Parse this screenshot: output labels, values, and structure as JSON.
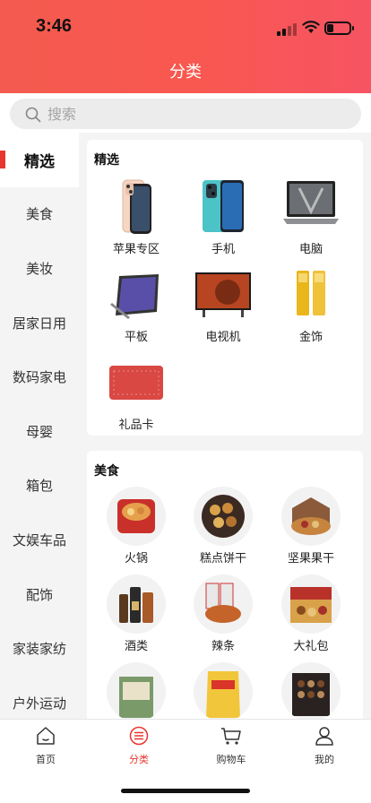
{
  "status": {
    "time": "3:46",
    "battery_level": 0.3
  },
  "header": {
    "title": "分类"
  },
  "search": {
    "placeholder": "搜索"
  },
  "colors": {
    "accent": "#e8352e",
    "header_start": "#f45a4f",
    "header_end": "#f75463"
  },
  "sidebar": {
    "items": [
      {
        "label": "精选",
        "active": true
      },
      {
        "label": "美食"
      },
      {
        "label": "美妆"
      },
      {
        "label": "居家日用"
      },
      {
        "label": "数码家电"
      },
      {
        "label": "母婴"
      },
      {
        "label": "箱包"
      },
      {
        "label": "文娱车品"
      },
      {
        "label": "配饰"
      },
      {
        "label": "家装家纺"
      },
      {
        "label": "户外运动"
      }
    ]
  },
  "sections": [
    {
      "title": "精选",
      "items": [
        {
          "label": "苹果专区",
          "icon": "iphone-icon"
        },
        {
          "label": "手机",
          "icon": "phone-icon"
        },
        {
          "label": "电脑",
          "icon": "laptop-icon"
        },
        {
          "label": "平板",
          "icon": "tablet-icon"
        },
        {
          "label": "电视机",
          "icon": "tv-icon"
        },
        {
          "label": "金饰",
          "icon": "gold-bar-icon"
        },
        {
          "label": "礼品卡",
          "icon": "gift-card-icon"
        }
      ]
    },
    {
      "title": "美食",
      "items": [
        {
          "label": "火锅",
          "icon": "hotpot-icon"
        },
        {
          "label": "糕点饼干",
          "icon": "cookies-icon"
        },
        {
          "label": "坚果果干",
          "icon": "nuts-icon"
        },
        {
          "label": "酒类",
          "icon": "liquor-icon"
        },
        {
          "label": "辣条",
          "icon": "spicy-snack-icon"
        },
        {
          "label": "大礼包",
          "icon": "gift-box-icon"
        },
        {
          "label": "",
          "icon": "tea-box-icon"
        },
        {
          "label": "",
          "icon": "chips-icon"
        },
        {
          "label": "",
          "icon": "chocolate-box-icon"
        }
      ]
    }
  ],
  "tabbar": {
    "items": [
      {
        "label": "首页",
        "icon": "home-icon"
      },
      {
        "label": "分类",
        "icon": "category-icon",
        "active": true
      },
      {
        "label": "购物车",
        "icon": "cart-icon"
      },
      {
        "label": "我的",
        "icon": "user-icon"
      }
    ]
  }
}
